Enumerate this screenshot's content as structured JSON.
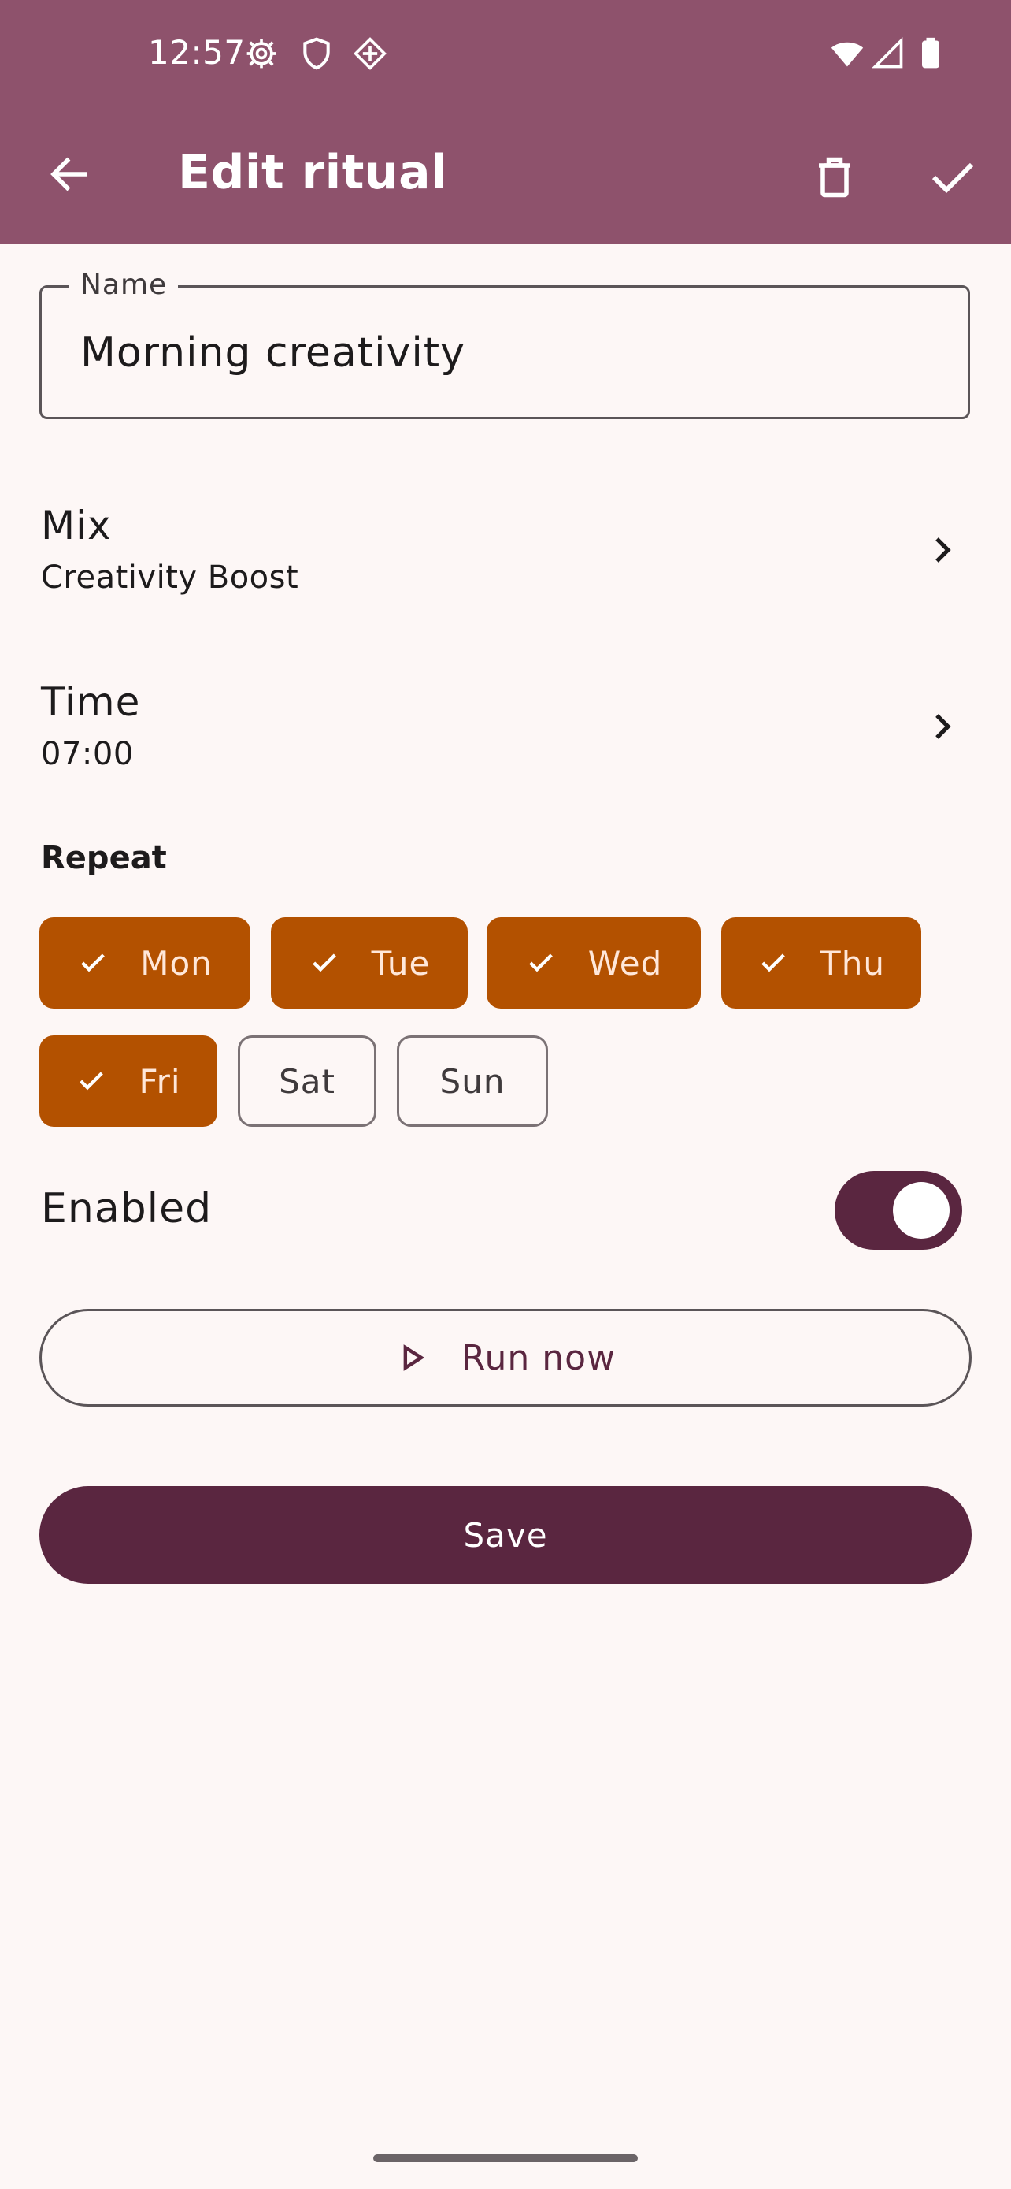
{
  "status_bar": {
    "time": "12:57",
    "icons_left": [
      "gear-icon",
      "shield-icon",
      "diamond-grid-icon"
    ],
    "icons_right": [
      "wifi-icon",
      "cell-signal-icon",
      "battery-icon"
    ]
  },
  "app_bar": {
    "title": "Edit ritual",
    "back_icon": "arrow-left-icon",
    "actions": [
      "delete-icon",
      "check-icon"
    ]
  },
  "name_field": {
    "label": "Name",
    "value": "Morning creativity"
  },
  "mix_row": {
    "title": "Mix",
    "value": "Creativity Boost"
  },
  "time_row": {
    "title": "Time",
    "value": "07:00"
  },
  "repeat": {
    "heading": "Repeat",
    "days": [
      {
        "label": "Mon",
        "selected": true
      },
      {
        "label": "Tue",
        "selected": true
      },
      {
        "label": "Wed",
        "selected": true
      },
      {
        "label": "Thu",
        "selected": true
      },
      {
        "label": "Fri",
        "selected": true
      },
      {
        "label": "Sat",
        "selected": false
      },
      {
        "label": "Sun",
        "selected": false
      }
    ]
  },
  "enabled": {
    "label": "Enabled",
    "on": true
  },
  "buttons": {
    "run_now": "Run now",
    "save": "Save"
  },
  "colors": {
    "app_bar": "#8e526c",
    "background": "#fdf7f6",
    "chip_selected": "#b35100",
    "primary": "#5a2640"
  }
}
